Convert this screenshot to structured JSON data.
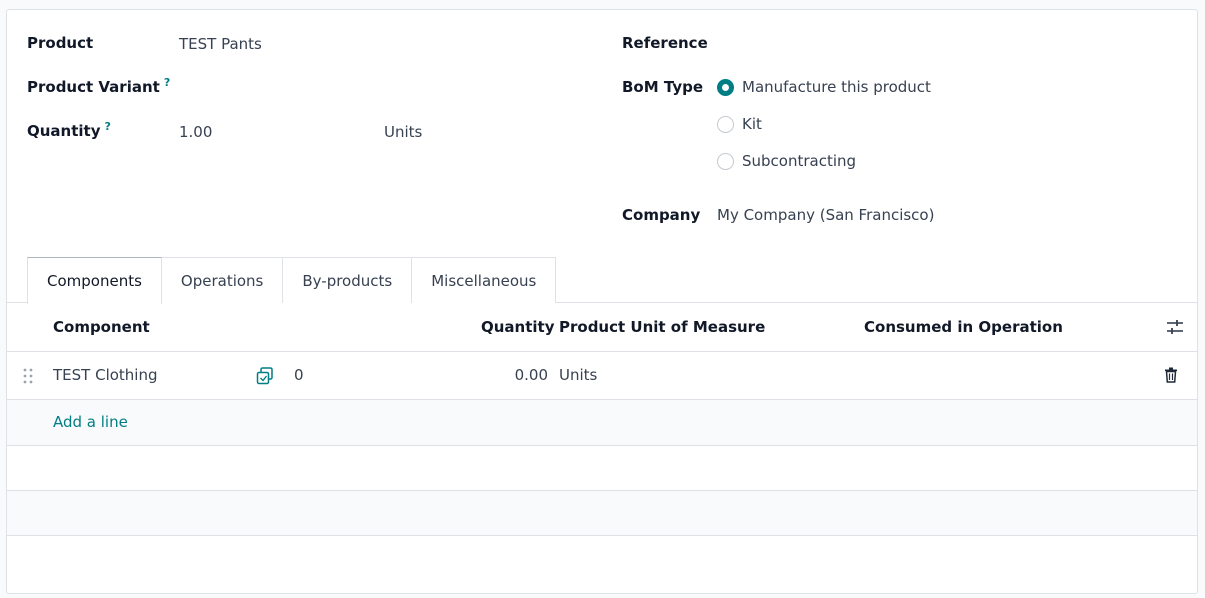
{
  "form": {
    "product_label": "Product",
    "product_value": "TEST Pants",
    "variant_label": "Product Variant",
    "variant_help": "?",
    "quantity_label": "Quantity",
    "quantity_help": "?",
    "quantity_value": "1.00",
    "quantity_uom": "Units",
    "reference_label": "Reference",
    "bom_type_label": "BoM Type",
    "bom_type_options": [
      {
        "label": "Manufacture this product",
        "checked": true
      },
      {
        "label": "Kit",
        "checked": false
      },
      {
        "label": "Subcontracting",
        "checked": false
      }
    ],
    "company_label": "Company",
    "company_value": "My Company (San Francisco)"
  },
  "tabs": [
    {
      "label": "Components",
      "active": true
    },
    {
      "label": "Operations",
      "active": false
    },
    {
      "label": "By-products",
      "active": false
    },
    {
      "label": "Miscellaneous",
      "active": false
    }
  ],
  "table": {
    "headers": {
      "component": "Component",
      "quantity": "Quantity",
      "uom": "Product Unit of Measure",
      "consumed": "Consumed in Operation"
    },
    "rows": [
      {
        "component": "TEST Clothing",
        "count": "0",
        "quantity": "0.00",
        "uom": "Units",
        "consumed": ""
      }
    ],
    "add_line": "Add a line"
  },
  "colors": {
    "accent": "#017e84",
    "border": "#dee2e6"
  },
  "icons": {
    "drag": "drag-handle-icon",
    "copy": "copy-icon",
    "settings": "sliders-icon",
    "delete": "trash-icon"
  }
}
